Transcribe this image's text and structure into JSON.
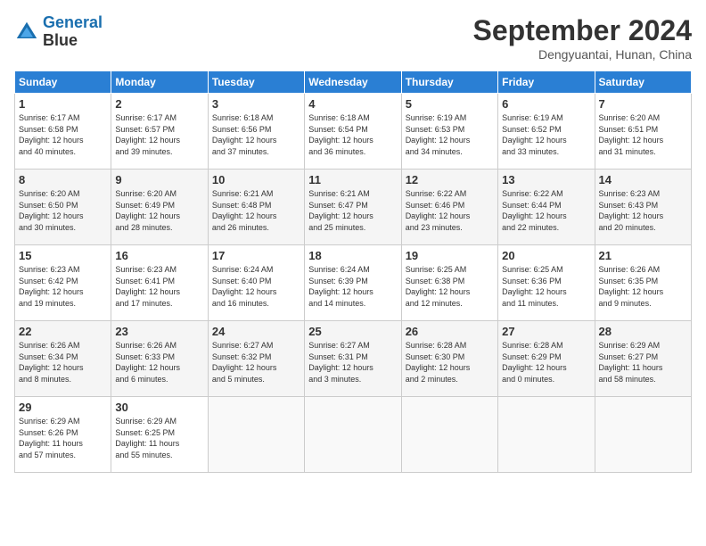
{
  "logo": {
    "line1": "General",
    "line2": "Blue"
  },
  "title": "September 2024",
  "location": "Dengyuantai, Hunan, China",
  "days_header": [
    "Sunday",
    "Monday",
    "Tuesday",
    "Wednesday",
    "Thursday",
    "Friday",
    "Saturday"
  ],
  "weeks": [
    [
      {
        "day": "1",
        "info": "Sunrise: 6:17 AM\nSunset: 6:58 PM\nDaylight: 12 hours\nand 40 minutes."
      },
      {
        "day": "2",
        "info": "Sunrise: 6:17 AM\nSunset: 6:57 PM\nDaylight: 12 hours\nand 39 minutes."
      },
      {
        "day": "3",
        "info": "Sunrise: 6:18 AM\nSunset: 6:56 PM\nDaylight: 12 hours\nand 37 minutes."
      },
      {
        "day": "4",
        "info": "Sunrise: 6:18 AM\nSunset: 6:54 PM\nDaylight: 12 hours\nand 36 minutes."
      },
      {
        "day": "5",
        "info": "Sunrise: 6:19 AM\nSunset: 6:53 PM\nDaylight: 12 hours\nand 34 minutes."
      },
      {
        "day": "6",
        "info": "Sunrise: 6:19 AM\nSunset: 6:52 PM\nDaylight: 12 hours\nand 33 minutes."
      },
      {
        "day": "7",
        "info": "Sunrise: 6:20 AM\nSunset: 6:51 PM\nDaylight: 12 hours\nand 31 minutes."
      }
    ],
    [
      {
        "day": "8",
        "info": "Sunrise: 6:20 AM\nSunset: 6:50 PM\nDaylight: 12 hours\nand 30 minutes."
      },
      {
        "day": "9",
        "info": "Sunrise: 6:20 AM\nSunset: 6:49 PM\nDaylight: 12 hours\nand 28 minutes."
      },
      {
        "day": "10",
        "info": "Sunrise: 6:21 AM\nSunset: 6:48 PM\nDaylight: 12 hours\nand 26 minutes."
      },
      {
        "day": "11",
        "info": "Sunrise: 6:21 AM\nSunset: 6:47 PM\nDaylight: 12 hours\nand 25 minutes."
      },
      {
        "day": "12",
        "info": "Sunrise: 6:22 AM\nSunset: 6:46 PM\nDaylight: 12 hours\nand 23 minutes."
      },
      {
        "day": "13",
        "info": "Sunrise: 6:22 AM\nSunset: 6:44 PM\nDaylight: 12 hours\nand 22 minutes."
      },
      {
        "day": "14",
        "info": "Sunrise: 6:23 AM\nSunset: 6:43 PM\nDaylight: 12 hours\nand 20 minutes."
      }
    ],
    [
      {
        "day": "15",
        "info": "Sunrise: 6:23 AM\nSunset: 6:42 PM\nDaylight: 12 hours\nand 19 minutes."
      },
      {
        "day": "16",
        "info": "Sunrise: 6:23 AM\nSunset: 6:41 PM\nDaylight: 12 hours\nand 17 minutes."
      },
      {
        "day": "17",
        "info": "Sunrise: 6:24 AM\nSunset: 6:40 PM\nDaylight: 12 hours\nand 16 minutes."
      },
      {
        "day": "18",
        "info": "Sunrise: 6:24 AM\nSunset: 6:39 PM\nDaylight: 12 hours\nand 14 minutes."
      },
      {
        "day": "19",
        "info": "Sunrise: 6:25 AM\nSunset: 6:38 PM\nDaylight: 12 hours\nand 12 minutes."
      },
      {
        "day": "20",
        "info": "Sunrise: 6:25 AM\nSunset: 6:36 PM\nDaylight: 12 hours\nand 11 minutes."
      },
      {
        "day": "21",
        "info": "Sunrise: 6:26 AM\nSunset: 6:35 PM\nDaylight: 12 hours\nand 9 minutes."
      }
    ],
    [
      {
        "day": "22",
        "info": "Sunrise: 6:26 AM\nSunset: 6:34 PM\nDaylight: 12 hours\nand 8 minutes."
      },
      {
        "day": "23",
        "info": "Sunrise: 6:26 AM\nSunset: 6:33 PM\nDaylight: 12 hours\nand 6 minutes."
      },
      {
        "day": "24",
        "info": "Sunrise: 6:27 AM\nSunset: 6:32 PM\nDaylight: 12 hours\nand 5 minutes."
      },
      {
        "day": "25",
        "info": "Sunrise: 6:27 AM\nSunset: 6:31 PM\nDaylight: 12 hours\nand 3 minutes."
      },
      {
        "day": "26",
        "info": "Sunrise: 6:28 AM\nSunset: 6:30 PM\nDaylight: 12 hours\nand 2 minutes."
      },
      {
        "day": "27",
        "info": "Sunrise: 6:28 AM\nSunset: 6:29 PM\nDaylight: 12 hours\nand 0 minutes."
      },
      {
        "day": "28",
        "info": "Sunrise: 6:29 AM\nSunset: 6:27 PM\nDaylight: 11 hours\nand 58 minutes."
      }
    ],
    [
      {
        "day": "29",
        "info": "Sunrise: 6:29 AM\nSunset: 6:26 PM\nDaylight: 11 hours\nand 57 minutes."
      },
      {
        "day": "30",
        "info": "Sunrise: 6:29 AM\nSunset: 6:25 PM\nDaylight: 11 hours\nand 55 minutes."
      },
      {
        "day": "",
        "info": ""
      },
      {
        "day": "",
        "info": ""
      },
      {
        "day": "",
        "info": ""
      },
      {
        "day": "",
        "info": ""
      },
      {
        "day": "",
        "info": ""
      }
    ]
  ]
}
